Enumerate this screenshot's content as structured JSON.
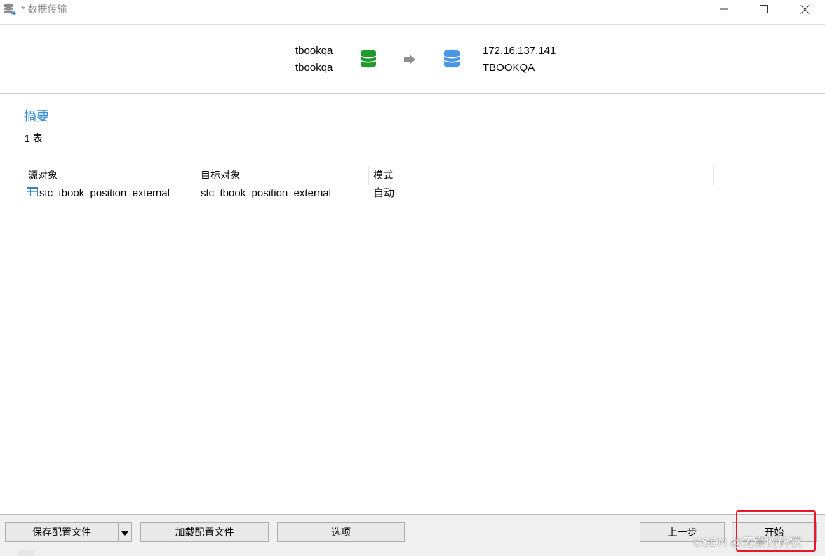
{
  "window": {
    "title": "* 数据传输",
    "icons": {
      "app": "database-transfer-icon",
      "minimize": "minimize-icon",
      "maximize": "maximize-icon",
      "close": "close-icon"
    }
  },
  "connection": {
    "source": {
      "name": "tbookqa",
      "database": "tbookqa",
      "icon": "database-icon",
      "color": "#1f9a2c"
    },
    "arrow_icon": "arrow-right-icon",
    "target": {
      "host": "172.16.137.141",
      "database": "TBOOKQA",
      "icon": "database-icon",
      "color": "#4a97e6"
    }
  },
  "summary": {
    "heading": "摘要",
    "count_text": "1 表",
    "heading_color": "#3a8ed3"
  },
  "table": {
    "columns": [
      "源对象",
      "目标对象",
      "模式"
    ],
    "rows": [
      {
        "icon": "table-icon",
        "source": "stc_tbook_position_external",
        "target": "stc_tbook_position_external",
        "mode": "自动"
      }
    ]
  },
  "buttons": {
    "save_profile": "保存配置文件",
    "save_dropdown_icon": "caret-down-icon",
    "load_profile": "加载配置文件",
    "options": "选项",
    "previous": "上一步",
    "start": "开始"
  },
  "watermark": "CSDN @无奈的码农",
  "highlight_color": "#e8182a"
}
